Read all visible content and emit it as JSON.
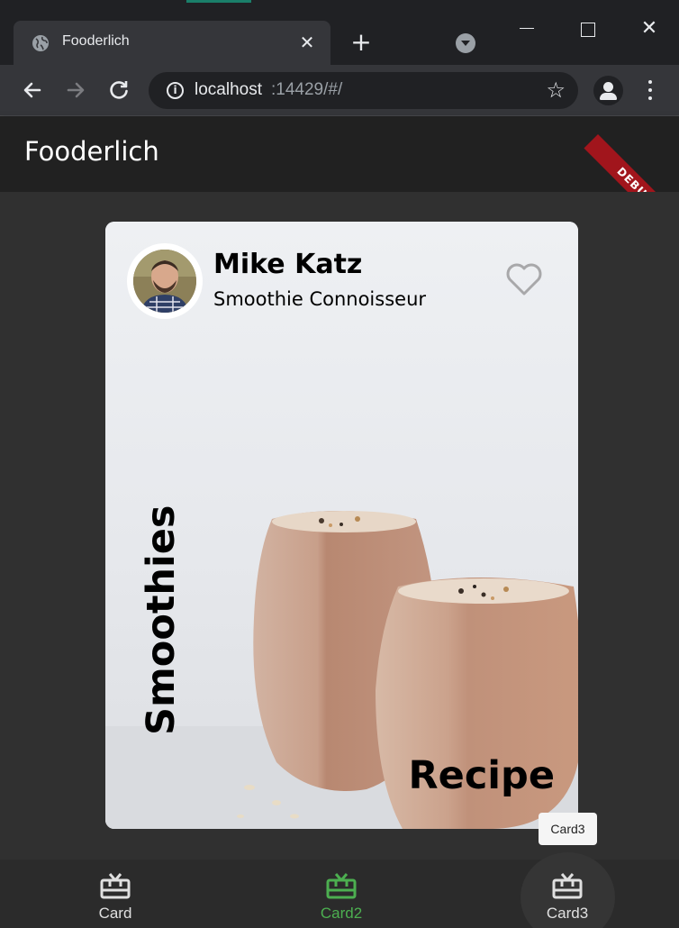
{
  "browser": {
    "tab_title": "Fooderlich",
    "url_host": "localhost",
    "url_rest": ":14429/#/",
    "icons": {
      "favicon": "globe-icon",
      "tab_close": "close-icon",
      "new_tab": "plus-icon",
      "tab_search": "chevron-down-icon",
      "back": "arrow-left-icon",
      "forward": "arrow-right-icon",
      "reload": "reload-icon",
      "site_info": "info-icon",
      "bookmark": "star-icon",
      "profile": "profile-icon",
      "menu": "kebab-menu-icon"
    }
  },
  "app": {
    "title": "Fooderlich",
    "debug_banner": "DEBUG",
    "colors": {
      "appbar": "#212121",
      "background": "#303030",
      "selected": "#4caf50",
      "unselected": "#e0e0e0"
    }
  },
  "card": {
    "author_name": "Mike Katz",
    "author_title": "Smoothie Connoisseur",
    "vertical_label": "Smoothies",
    "corner_label": "Recipe",
    "favorite_icon": "heart-outline-icon"
  },
  "tooltip": "Card3",
  "bottom_nav": {
    "items": [
      {
        "label": "Card",
        "icon": "card-giftcard-icon",
        "selected": false
      },
      {
        "label": "Card2",
        "icon": "card-giftcard-icon",
        "selected": true
      },
      {
        "label": "Card3",
        "icon": "card-giftcard-icon",
        "selected": false
      }
    ]
  }
}
